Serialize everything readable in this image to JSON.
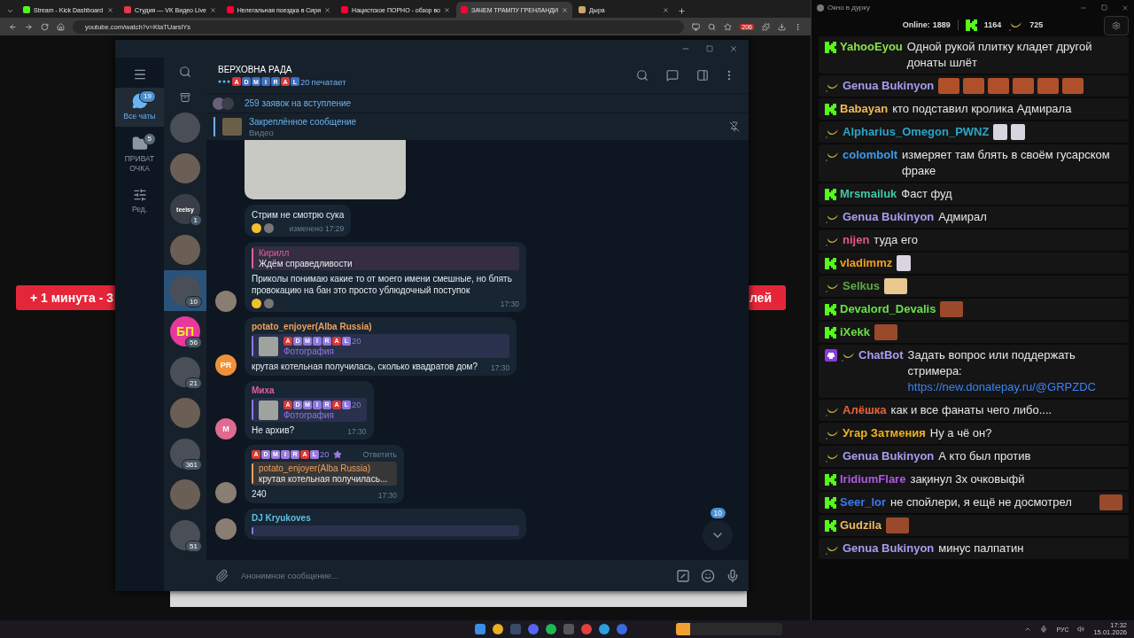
{
  "browser": {
    "tabs": [
      {
        "title": "Stream - Kick Dashboard",
        "kind": "kick",
        "selected": false
      },
      {
        "title": "Студия — VK Видео Live",
        "kind": "vk",
        "selected": false
      },
      {
        "title": "Нелегальная поездка в Сири",
        "kind": "youtube",
        "selected": false
      },
      {
        "title": "Нацистское ПОРНО - обзор во",
        "kind": "youtube",
        "selected": false
      },
      {
        "title": "ЗАЧЕМ ТРАМПУ ГРЕНЛАНДИ",
        "kind": "youtube",
        "selected": true
      },
      {
        "title": "Дыра",
        "kind": "site",
        "selected": false
      }
    ],
    "address": "youtube.com/watch?v=KtaTUarslYs",
    "extension_badge": "206",
    "banner": {
      "left": "+ 1 минута - 3",
      "right": "лей"
    }
  },
  "telegram": {
    "folders": [
      {
        "kind": "chats",
        "label": "Все чаты",
        "badge": "19",
        "selected": true
      },
      {
        "kind": "chats",
        "label": "ПРИВАТ ОЧКА",
        "badge": "5",
        "selected": false
      },
      {
        "kind": "edit",
        "label": "Ред.",
        "selected": false
      }
    ],
    "chats": [
      {
        "kind": "photo",
        "selected": false
      },
      {
        "kind": "photo",
        "selected": false
      },
      {
        "kind": "initials",
        "initials": "teeisy",
        "color": "#3a3f47",
        "badge": "1",
        "selected": false
      },
      {
        "kind": "photo",
        "selected": false
      },
      {
        "kind": "photo",
        "badge": "10",
        "selected": true
      },
      {
        "kind": "initials",
        "initials": "БП",
        "color": "#e8389c",
        "badge": "56",
        "selected": false
      },
      {
        "kind": "photo",
        "badge": "21",
        "selected": false
      },
      {
        "kind": "photo",
        "selected": false
      },
      {
        "kind": "photo",
        "badge": "361",
        "selected": false
      },
      {
        "kind": "photo",
        "selected": false
      },
      {
        "kind": "photo",
        "badge": "51",
        "selected": false
      }
    ],
    "title": "ВЕРХОВНА РАДА",
    "typing": {
      "tiles": [
        {
          "char": "A",
          "color": "#d93838"
        },
        {
          "char": "D",
          "color": "#3f6fbf"
        },
        {
          "char": "M",
          "color": "#3f6fbf"
        },
        {
          "char": "I",
          "color": "#3f6fbf"
        },
        {
          "char": "R",
          "color": "#3f6fbf"
        },
        {
          "char": "A",
          "color": "#d93838"
        },
        {
          "char": "L",
          "color": "#3f6fbf"
        }
      ],
      "suffix": "20",
      "text": "печатает"
    },
    "requests": "259 заявок на вступление",
    "pinned": {
      "title": "Закреплённое сообщение",
      "subtitle": "Видео"
    },
    "messages": [
      {
        "kind": "photo"
      },
      {
        "kind": "text",
        "text": "Стрим не смотрю сука",
        "reactions": true,
        "time": "изменено 17:29"
      },
      {
        "kind": "text",
        "avatar": {
          "kind": "photo"
        },
        "quote": {
          "name": "Кирилл",
          "color": "#e0609c",
          "text": "Ждём справедливости"
        },
        "text": "Приколы понимаю какие то от моего имени смешные, но блять провокацию на бан это просто ублюдочный поступок",
        "reactions": true,
        "time": "17:30"
      },
      {
        "kind": "text",
        "avatar": {
          "kind": "initials",
          "initials": "PR",
          "color": "#f0913a"
        },
        "sender": {
          "name": "potato_enjoyer(Alba Russia)",
          "color": "#f0a05a"
        },
        "quote": {
          "color": "#8f78e0",
          "tiles": [
            {
              "char": "A",
              "color": "#d93838"
            },
            {
              "char": "D",
              "color": "#8f78e0"
            },
            {
              "char": "M",
              "color": "#8f78e0"
            },
            {
              "char": "I",
              "color": "#8f78e0"
            },
            {
              "char": "R",
              "color": "#8f78e0"
            },
            {
              "char": "A",
              "color": "#d93838"
            },
            {
              "char": "L",
              "color": "#8f78e0"
            }
          ],
          "suffix": "20",
          "text": "Фотография",
          "thumb": true
        },
        "text": "крутая котельная получилась, сколько квадратов дом?",
        "reactions": false,
        "time": "17:30"
      },
      {
        "kind": "text",
        "avatar": {
          "kind": "initials",
          "initials": "M",
          "color": "#e06a90"
        },
        "sender": {
          "name": "Миха",
          "color": "#e060a0"
        },
        "quote": {
          "color": "#8f78e0",
          "tiles": [
            {
              "char": "A",
              "color": "#d93838"
            },
            {
              "char": "D",
              "color": "#8f78e0"
            },
            {
              "char": "M",
              "color": "#8f78e0"
            },
            {
              "char": "I",
              "color": "#8f78e0"
            },
            {
              "char": "R",
              "color": "#8f78e0"
            },
            {
              "char": "A",
              "color": "#d93838"
            },
            {
              "char": "L",
              "color": "#8f78e0"
            }
          ],
          "suffix": "20",
          "text": "Фотография",
          "thumb": true
        },
        "text": "Не архив?",
        "reactions": false,
        "time": "17:30"
      },
      {
        "kind": "text",
        "avatar": {
          "kind": "photo"
        },
        "sender": {
          "color": "#9b7be0",
          "tiles": [
            {
              "char": "A",
              "color": "#d93838"
            },
            {
              "char": "D",
              "color": "#9b7be0"
            },
            {
              "char": "M",
              "color": "#9b7be0"
            },
            {
              "char": "I",
              "color": "#9b7be0"
            },
            {
              "char": "R",
              "color": "#9b7be0"
            },
            {
              "char": "A",
              "color": "#d93838"
            },
            {
              "char": "L",
              "color": "#9b7be0"
            }
          ],
          "suffix": "20",
          "star": true,
          "action": "Ответить"
        },
        "quote": {
          "name": "potato_enjoyer(Alba Russia)",
          "color": "#f0a05a",
          "text": "крутая котельная получилась..."
        },
        "text": "240",
        "reactions": false,
        "time": "17:30"
      },
      {
        "kind": "partial",
        "avatar": {
          "kind": "photo"
        },
        "sender": {
          "name": "DJ Kryukoves",
          "color": "#5fc0e0"
        }
      }
    ],
    "scroll_badge": "10",
    "composer": {
      "placeholder": "Анонимное сообщение..."
    }
  },
  "chat_window": {
    "title": "Окно в дурку",
    "online_label": "Online:",
    "online": "1889",
    "kick_count": "1164",
    "other_count": "725",
    "messages": [
      {
        "kind": "kick",
        "name": "YahooEyou",
        "color": "#8be04a",
        "text": "Одной рукой плитку кладет другой донаты шлёт"
      },
      {
        "kind": "other",
        "name": "Genua Bukinyon",
        "color": "#a99cf0",
        "emotes": [
          {
            "kind": "cartoon"
          },
          {
            "kind": "cartoon"
          },
          {
            "kind": "cartoon"
          },
          {
            "kind": "cartoon"
          },
          {
            "kind": "cartoon"
          },
          {
            "kind": "cartoon"
          }
        ]
      },
      {
        "kind": "kick",
        "name": "Babayan",
        "color": "#f0b95a",
        "text": "кто подставил кролика Адмирала"
      },
      {
        "kind": "other",
        "name": "Alpharius_Omegon_PWNZ",
        "color": "#2aa5c8",
        "emotes": [
          {
            "kind": "ghost"
          },
          {
            "kind": "ghost"
          }
        ]
      },
      {
        "kind": "other",
        "name": "colombolt",
        "color": "#3a9bf0",
        "text": "измеряет там блять в своём гусарском фраке"
      },
      {
        "kind": "kick",
        "name": "Mrsmailuk",
        "color": "#3ec9a7",
        "text": "Фаст фуд"
      },
      {
        "kind": "other",
        "name": "Genua Bukinyon",
        "color": "#a99cf0",
        "text": "Адмирал"
      },
      {
        "kind": "other",
        "name": "nijen",
        "color": "#e05a8c",
        "text": "туда его"
      },
      {
        "kind": "kick",
        "name": "vladimmz",
        "color": "#f0a020",
        "emotes": [
          {
            "kind": "ghost"
          }
        ]
      },
      {
        "kind": "other",
        "name": "Selkus",
        "color": "#5fa84a",
        "emotes": [
          {
            "kind": "cat"
          }
        ]
      },
      {
        "kind": "kick",
        "name": "Devalord_Devalis",
        "color": "#6be04a",
        "emotes": [
          {
            "kind": "face"
          }
        ]
      },
      {
        "kind": "kick",
        "name": "iXekk",
        "color": "#6be04a",
        "emotes": [
          {
            "kind": "face"
          }
        ]
      },
      {
        "kind": "bot",
        "name": "ChatBot",
        "color": "#a99cf0",
        "text": "Задать вопрос или поддержать стримера: ",
        "link": "https://new.donatepay.ru/@GRPZDC"
      },
      {
        "kind": "other",
        "name": "Алёшка",
        "color": "#e8643a",
        "text": "как и все фанаты чего либо...."
      },
      {
        "kind": "other",
        "name": "Угар Затмения",
        "color": "#f0b020",
        "text": "Ну а чё он?"
      },
      {
        "kind": "other",
        "name": "Genua Bukinyon",
        "color": "#a99cf0",
        "text": "А кто был против"
      },
      {
        "kind": "kick",
        "name": "IridiumFlare",
        "color": "#b05ae0",
        "text": "зақинул 3х очковыфй"
      },
      {
        "kind": "kick",
        "name": "Seer_lor",
        "color": "#3a7bf0",
        "text": "не спойлери, я ещё не досмотрел",
        "emotes": [
          {
            "kind": "face"
          }
        ]
      },
      {
        "kind": "kick",
        "name": "Gudzila",
        "color": "#f0b95a",
        "emotes": [
          {
            "kind": "face"
          }
        ]
      },
      {
        "kind": "other",
        "name": "Genua Bukinyon",
        "color": "#a99cf0",
        "text": "минус палпатин"
      }
    ]
  },
  "taskbar": {
    "language": "РУС",
    "time": "17:32",
    "date": "15.01.2026"
  }
}
